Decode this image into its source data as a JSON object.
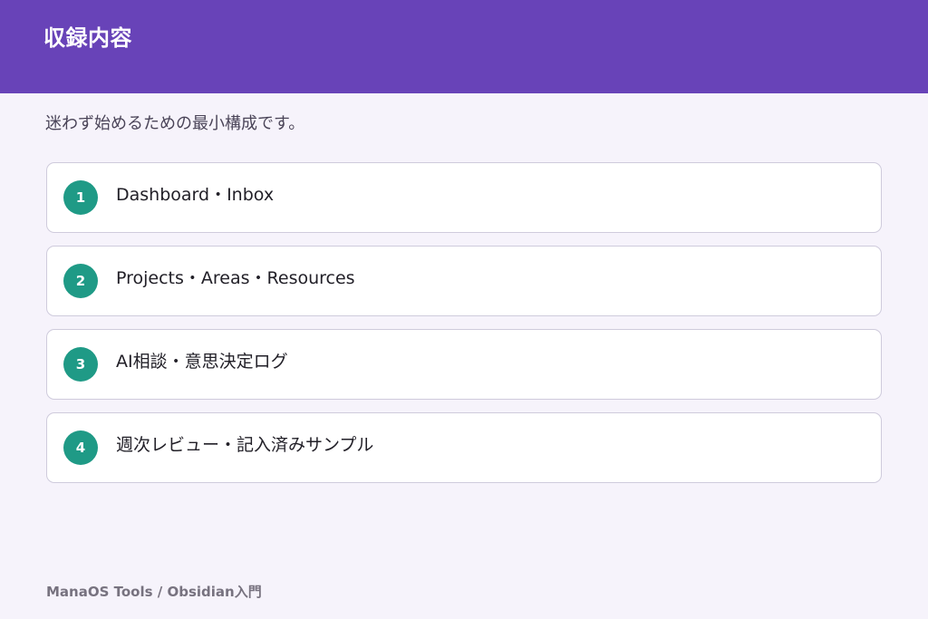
{
  "header": {
    "title": "収録内容"
  },
  "intro": "迷わず始めるための最小構成です。",
  "items": [
    {
      "number": "1",
      "label": "Dashboard・Inbox"
    },
    {
      "number": "2",
      "label": "Projects・Areas・Resources"
    },
    {
      "number": "3",
      "label": "AI相談・意思決定ログ"
    },
    {
      "number": "4",
      "label": "週次レビュー・記入済みサンプル"
    }
  ],
  "footer": "ManaOS Tools / Obsidian入門",
  "colors": {
    "header_bg": "#6843b8",
    "badge_bg": "#1f9a86",
    "page_bg": "#f6f3fb"
  }
}
